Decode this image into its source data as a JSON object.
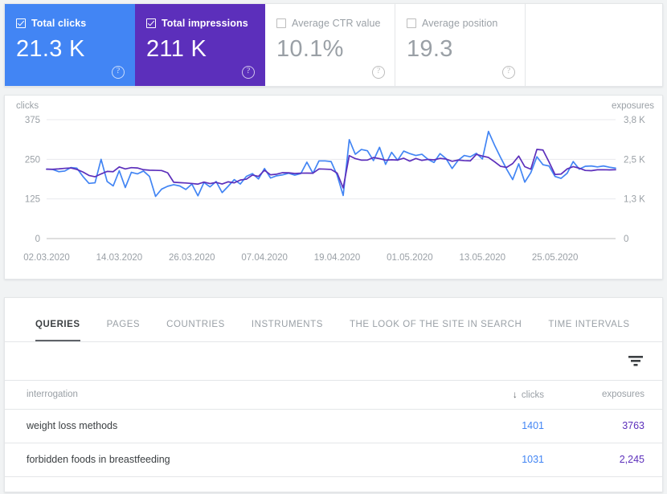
{
  "metrics": [
    {
      "label": "Total clicks",
      "value": "21.3 K",
      "checked": true,
      "style": "blue",
      "help": "?"
    },
    {
      "label": "Total impressions",
      "value": "211 K",
      "checked": true,
      "style": "purple",
      "help": "?"
    },
    {
      "label": "Average CTR value",
      "value": "10.1%",
      "checked": false,
      "style": "plain",
      "help": "?"
    },
    {
      "label": "Average position",
      "value": "19.3",
      "checked": false,
      "style": "plain",
      "help": "?"
    }
  ],
  "colors": {
    "clicks_blue": "#4285f4",
    "impressions_purple": "#5c2fbb",
    "grid": "#e8eaed",
    "text_muted": "#9aa0a6"
  },
  "chart_data": {
    "type": "line",
    "title": "",
    "left_axis_label": "clicks",
    "right_axis_label": "exposures",
    "left_ticks": [
      "375",
      "250",
      "125",
      "0"
    ],
    "right_ticks": [
      "3,8 K",
      "2,5 K",
      "1,3 K",
      "0"
    ],
    "left_ylim": [
      0,
      375
    ],
    "right_ylim": [
      0,
      3800
    ],
    "grid": true,
    "legend": "none",
    "x_tick_labels": [
      "02.03.2020",
      "14.03.2020",
      "26.03.2020",
      "07.04.2020",
      "19.04.2020",
      "01.05.2020",
      "13.05.2020",
      "25.05.2020"
    ],
    "x_tick_indices": [
      0,
      12,
      24,
      36,
      48,
      60,
      72,
      84
    ],
    "series": [
      {
        "name": "clicks",
        "color": "#4285f4",
        "axis": "left",
        "values": [
          219,
          218,
          211,
          213,
          224,
          222,
          196,
          174,
          176,
          250,
          180,
          166,
          214,
          161,
          209,
          204,
          213,
          196,
          133,
          156,
          165,
          170,
          166,
          155,
          172,
          135,
          177,
          163,
          180,
          145,
          165,
          186,
          172,
          196,
          205,
          188,
          221,
          191,
          198,
          201,
          206,
          200,
          205,
          241,
          206,
          245,
          245,
          243,
          200,
          136,
          312,
          266,
          281,
          277,
          246,
          288,
          234,
          272,
          247,
          276,
          268,
          262,
          266,
          250,
          240,
          268,
          252,
          221,
          247,
          262,
          258,
          269,
          251,
          338,
          295,
          256,
          219,
          186,
          236,
          178,
          208,
          258,
          233,
          229,
          196,
          190,
          206,
          243,
          219,
          228,
          229,
          226,
          229,
          225,
          222
        ]
      },
      {
        "name": "exposures",
        "color": "#5c2fbb",
        "axis": "right",
        "values": [
          2218,
          2214,
          2227,
          2245,
          2258,
          2209,
          2128,
          2018,
          1976,
          2066,
          2147,
          2138,
          2290,
          2226,
          2268,
          2257,
          2201,
          2185,
          2181,
          2174,
          2102,
          1801,
          1788,
          1777,
          1761,
          1740,
          1804,
          1758,
          1796,
          1745,
          1814,
          1782,
          1871,
          1898,
          2031,
          1988,
          2184,
          2038,
          2058,
          2106,
          2102,
          2080,
          2091,
          2092,
          2090,
          2226,
          2219,
          2210,
          2093,
          1619,
          2652,
          2556,
          2507,
          2510,
          2590,
          2555,
          2505,
          2520,
          2510,
          2568,
          2476,
          2560,
          2500,
          2530,
          2516,
          2564,
          2540,
          2470,
          2510,
          2492,
          2484,
          2690,
          2636,
          2593,
          2457,
          2310,
          2276,
          2398,
          2636,
          2298,
          2218,
          2850,
          2830,
          2452,
          2048,
          2062,
          2226,
          2300,
          2250,
          2178,
          2170,
          2198,
          2200,
          2196,
          2200
        ]
      }
    ]
  },
  "tabs": [
    {
      "label": "QUERIES",
      "active": true
    },
    {
      "label": "PAGES",
      "active": false
    },
    {
      "label": "COUNTRIES",
      "active": false
    },
    {
      "label": "INSTRUMENTS",
      "active": false
    },
    {
      "label": "THE LOOK OF THE SITE IN SEARCH",
      "active": false
    },
    {
      "label": "TIME INTERVALS",
      "active": false
    }
  ],
  "table": {
    "columns": {
      "query": "interrogation",
      "clicks": "clicks",
      "exposures": "exposures",
      "sort_arrow": "↓"
    },
    "rows": [
      {
        "query": "weight loss methods",
        "clicks": "1401",
        "exposures": "3763"
      },
      {
        "query": "forbidden foods in breastfeeding",
        "clicks": "1031",
        "exposures": "2,245"
      }
    ]
  }
}
